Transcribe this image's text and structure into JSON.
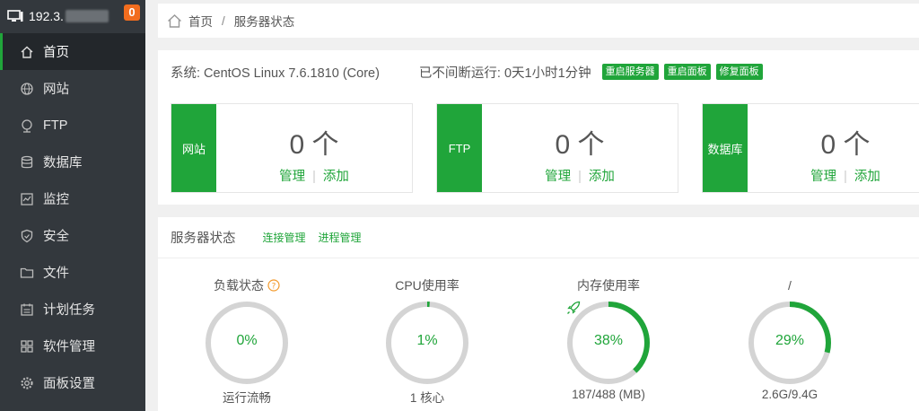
{
  "sidebar": {
    "ip": "192.3.",
    "badge": "0",
    "items": [
      {
        "label": "首页",
        "icon": "home-icon",
        "active": true
      },
      {
        "label": "网站",
        "icon": "globe-icon"
      },
      {
        "label": "FTP",
        "icon": "ftp-icon"
      },
      {
        "label": "数据库",
        "icon": "database-icon"
      },
      {
        "label": "监控",
        "icon": "monitor-icon"
      },
      {
        "label": "安全",
        "icon": "shield-icon"
      },
      {
        "label": "文件",
        "icon": "folder-icon"
      },
      {
        "label": "计划任务",
        "icon": "calendar-icon"
      },
      {
        "label": "软件管理",
        "icon": "apps-icon"
      },
      {
        "label": "面板设置",
        "icon": "gear-icon"
      }
    ]
  },
  "breadcrumb": {
    "home": "首页",
    "sep": "/",
    "current": "服务器状态"
  },
  "system": {
    "os": "系统: CentOS Linux 7.6.1810 (Core)",
    "uptime": "已不间断运行: 0天1小时1分钟",
    "buttons": [
      "重启服务器",
      "重启面板",
      "修复面板"
    ]
  },
  "cards": [
    {
      "tag": "网站",
      "count": "0 个",
      "manage": "管理",
      "add": "添加"
    },
    {
      "tag": "FTP",
      "count": "0 个",
      "manage": "管理",
      "add": "添加"
    },
    {
      "tag": "数据库",
      "count": "0 个",
      "manage": "管理",
      "add": "添加"
    }
  ],
  "status": {
    "title": "服务器状态",
    "links": [
      "连接管理",
      "进程管理"
    ],
    "gauges": [
      {
        "label": "负载状态",
        "percent": 0,
        "value": "0%",
        "sub": "运行流畅"
      },
      {
        "label": "CPU使用率",
        "percent": 1,
        "value": "1%",
        "sub": "1 核心"
      },
      {
        "label": "内存使用率",
        "percent": 38,
        "value": "38%",
        "sub": "187/488 (MB)"
      },
      {
        "label": "/",
        "percent": 29,
        "value": "29%",
        "sub": "2.6G/9.4G"
      }
    ]
  },
  "colors": {
    "accent": "#20a53a",
    "sidebar": "#33383d",
    "badge": "#f26d1e",
    "track": "#d4d4d4"
  }
}
